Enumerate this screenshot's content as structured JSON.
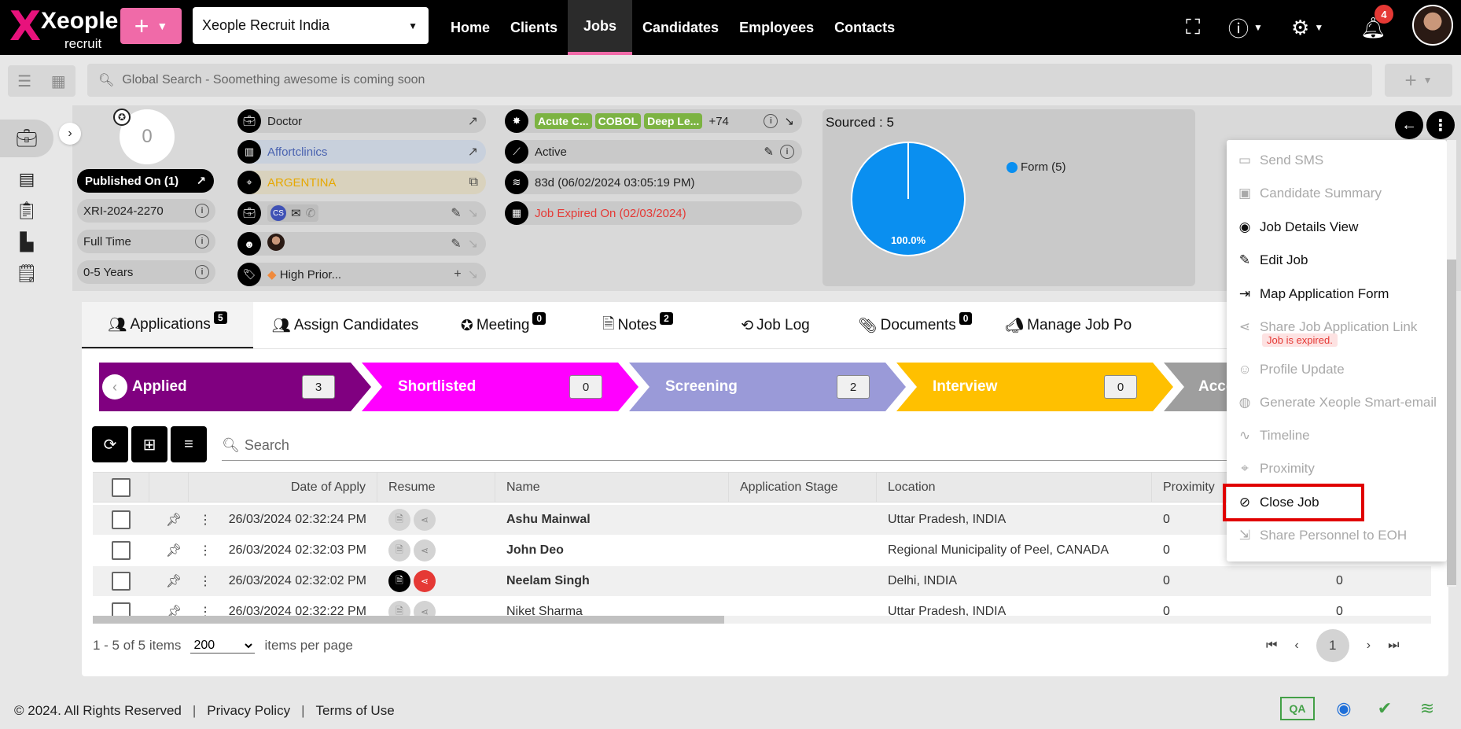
{
  "app": {
    "logo": "Xeople",
    "logo_sub": "recruit",
    "company": "Xeople Recruit India"
  },
  "nav": [
    "Home",
    "Clients",
    "Jobs",
    "Candidates",
    "Employees",
    "Contacts"
  ],
  "notifications": "4",
  "search": {
    "placeholder": "Global Search - Soomething awesome is coming soon"
  },
  "job": {
    "score": "0",
    "published": "Published On (1)",
    "code": "XRI-2024-2270",
    "type": "Full Time",
    "experience": "0-5 Years",
    "title": "Doctor",
    "client": "Affortclinics",
    "country": "ARGENTINA",
    "contact_initials": "CS",
    "tag": "High Prior...",
    "skills": [
      "Acute C...",
      "COBOL",
      "Deep Le..."
    ],
    "skills_more": "+74",
    "status": "Active",
    "age": "83d (06/02/2024 03:05:19 PM)",
    "expired": "Job Expired On (02/03/2024)"
  },
  "sourced": {
    "title": "Sourced : 5",
    "legend": "Form (5)",
    "pct_label": "100.0%",
    "color": "#0a8ff0"
  },
  "chart_data": {
    "type": "pie",
    "title": "Sourced : 5",
    "categories": [
      "Form"
    ],
    "values": [
      5
    ],
    "labels": [
      "100.0%"
    ],
    "legend_position": "right"
  },
  "tabs": [
    {
      "label": "Applications",
      "count": "5"
    },
    {
      "label": "Assign Candidates",
      "count": ""
    },
    {
      "label": "Meeting",
      "count": "0"
    },
    {
      "label": "Notes",
      "count": "2"
    },
    {
      "label": "Job Log",
      "count": ""
    },
    {
      "label": "Documents",
      "count": "0"
    },
    {
      "label": "Manage Job Po",
      "count": ""
    }
  ],
  "stages": [
    {
      "label": "Applied",
      "count": "3",
      "color": "#800080"
    },
    {
      "label": "Shortlisted",
      "count": "0",
      "color": "#ff00ff"
    },
    {
      "label": "Screening",
      "count": "2",
      "color": "#9a9ad8"
    },
    {
      "label": "Interview",
      "count": "0",
      "color": "#ffc000"
    },
    {
      "label": "Acce",
      "count": "",
      "color": "#9e9e9e"
    }
  ],
  "grid": {
    "search_placeholder": "Search",
    "columns": [
      "Date of Apply",
      "Resume",
      "Name",
      "Application Stage",
      "Location",
      "Proximity"
    ],
    "rows": [
      {
        "date": "26/03/2024 02:32:24 PM",
        "name": "Ashu Mainwal",
        "location": "Uttar Pradesh, INDIA",
        "proximity": "0",
        "extra": ""
      },
      {
        "date": "26/03/2024 02:32:03 PM",
        "name": "John Deo",
        "location": "Regional Municipality of Peel, CANADA",
        "proximity": "0",
        "extra": ""
      },
      {
        "date": "26/03/2024 02:32:02 PM",
        "name": "Neelam Singh",
        "location": "Delhi, INDIA",
        "proximity": "0",
        "extra": "0"
      },
      {
        "date": "26/03/2024 02:32:22 PM",
        "name": "Niket Sharma",
        "location": "Uttar Pradesh, INDIA",
        "proximity": "0",
        "extra": "0"
      }
    ],
    "summary": "1 - 5 of 5 items",
    "page_size": "200",
    "page_size_label": "items per page",
    "page": "1"
  },
  "menu": {
    "items": [
      {
        "label": "Send SMS",
        "icon": "sms-icon",
        "glyph": "▭",
        "enabled": false
      },
      {
        "label": "Candidate Summary",
        "icon": "summary-icon",
        "glyph": "▣",
        "enabled": false
      },
      {
        "label": "Job Details View",
        "icon": "eye-icon",
        "glyph": "◉",
        "enabled": true
      },
      {
        "label": "Edit Job",
        "icon": "pencil-icon",
        "glyph": "✎",
        "enabled": true
      },
      {
        "label": "Map Application Form",
        "icon": "map-form-icon",
        "glyph": "⇥",
        "enabled": true
      },
      {
        "label": "Share Job Application Link",
        "icon": "share-icon",
        "glyph": "⋖",
        "enabled": false
      },
      {
        "label": "Profile Update",
        "icon": "profile-icon",
        "glyph": "☺",
        "enabled": false
      },
      {
        "label": "Generate Xeople Smart-email",
        "icon": "smart-email-icon",
        "glyph": "◍",
        "enabled": false
      },
      {
        "label": "Timeline",
        "icon": "timeline-icon",
        "glyph": "∿",
        "enabled": false
      },
      {
        "label": "Proximity",
        "icon": "location-icon",
        "glyph": "⌖",
        "enabled": false
      },
      {
        "label": "Close Job",
        "icon": "block-icon",
        "glyph": "⊘",
        "enabled": true
      },
      {
        "label": "Share Personnel to EOH",
        "icon": "share-personnel-icon",
        "glyph": "⇲",
        "enabled": false
      }
    ],
    "expired_badge": "Job is expired."
  },
  "footer": {
    "copyright": "© 2024. All Rights Reserved",
    "privacy": "Privacy Policy",
    "terms": "Terms of Use",
    "env": "QA"
  }
}
